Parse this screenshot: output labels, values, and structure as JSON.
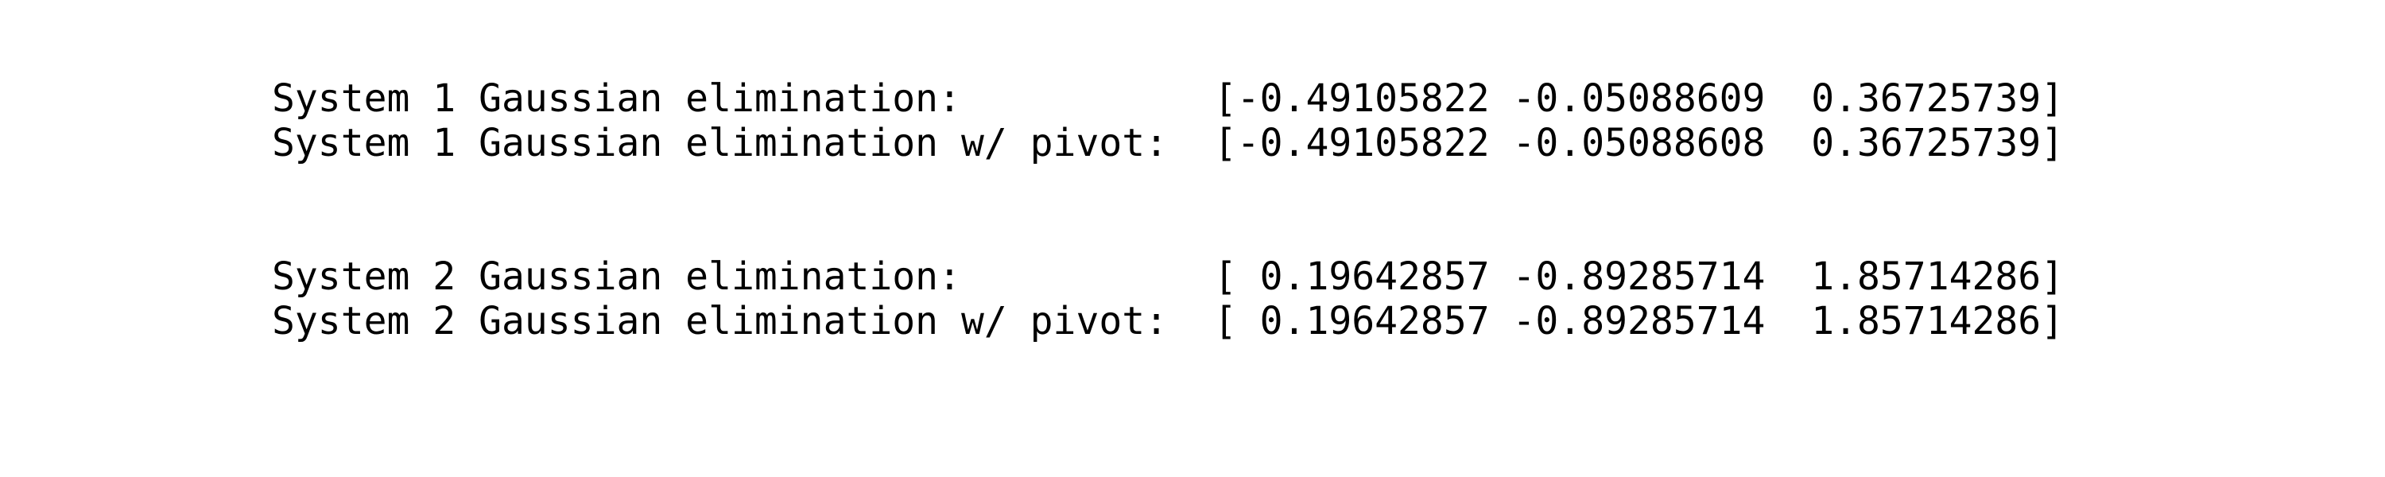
{
  "output": {
    "system1": {
      "plain_label": "System 1 Gaussian elimination:",
      "plain_value": "[-0.49105822 -0.05088609  0.36725739]",
      "pivot_label": "System 1 Gaussian elimination w/ pivot:",
      "pivot_value": "[-0.49105822 -0.05088608  0.36725739]"
    },
    "system2": {
      "plain_label": "System 2 Gaussian elimination:",
      "plain_value": "[ 0.19642857 -0.89285714  1.85714286]",
      "pivot_label": "System 2 Gaussian elimination w/ pivot:",
      "pivot_value": "[ 0.19642857 -0.89285714  1.85714286]"
    }
  }
}
